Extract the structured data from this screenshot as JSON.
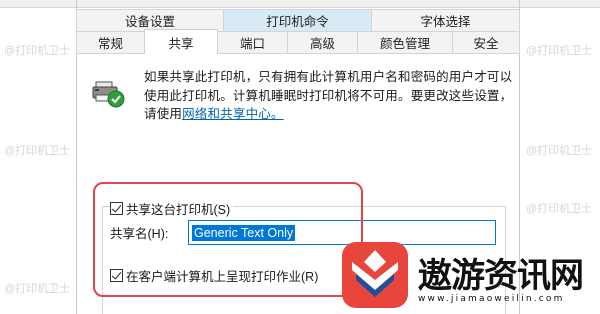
{
  "tabs": {
    "back_row": [
      "设备设置",
      "打印机命令",
      "字体选择"
    ],
    "front_row": [
      "常规",
      "共享",
      "端口",
      "高级",
      "颜色管理",
      "安全"
    ],
    "active": "共享"
  },
  "info": {
    "text": "如果共享此打印机，只有拥有此计算机用户名和密码的用户才可以使用此打印机。计算机睡眠时打印机将不可用。要更改这些设置，请使用",
    "link": "网络和共享中心。"
  },
  "share": {
    "checkbox_label": "共享这台打印机(S)",
    "checked": true,
    "name_label": "共享名(H):",
    "name_value": "Generic  Text Only",
    "render_label": "在客户端计算机上呈现打印作业(R)",
    "render_checked": true
  },
  "watermark": "@打印机卫士",
  "brand": {
    "name": "遨游资讯网",
    "url": "www.jiamaoweilin.com",
    "colors": {
      "logo_bg": "#e8463d",
      "logo_blue": "#1c4f9c"
    }
  },
  "colors": {
    "highlight": "#e6444c",
    "link": "#0063b1",
    "selection": "#0078d7"
  }
}
